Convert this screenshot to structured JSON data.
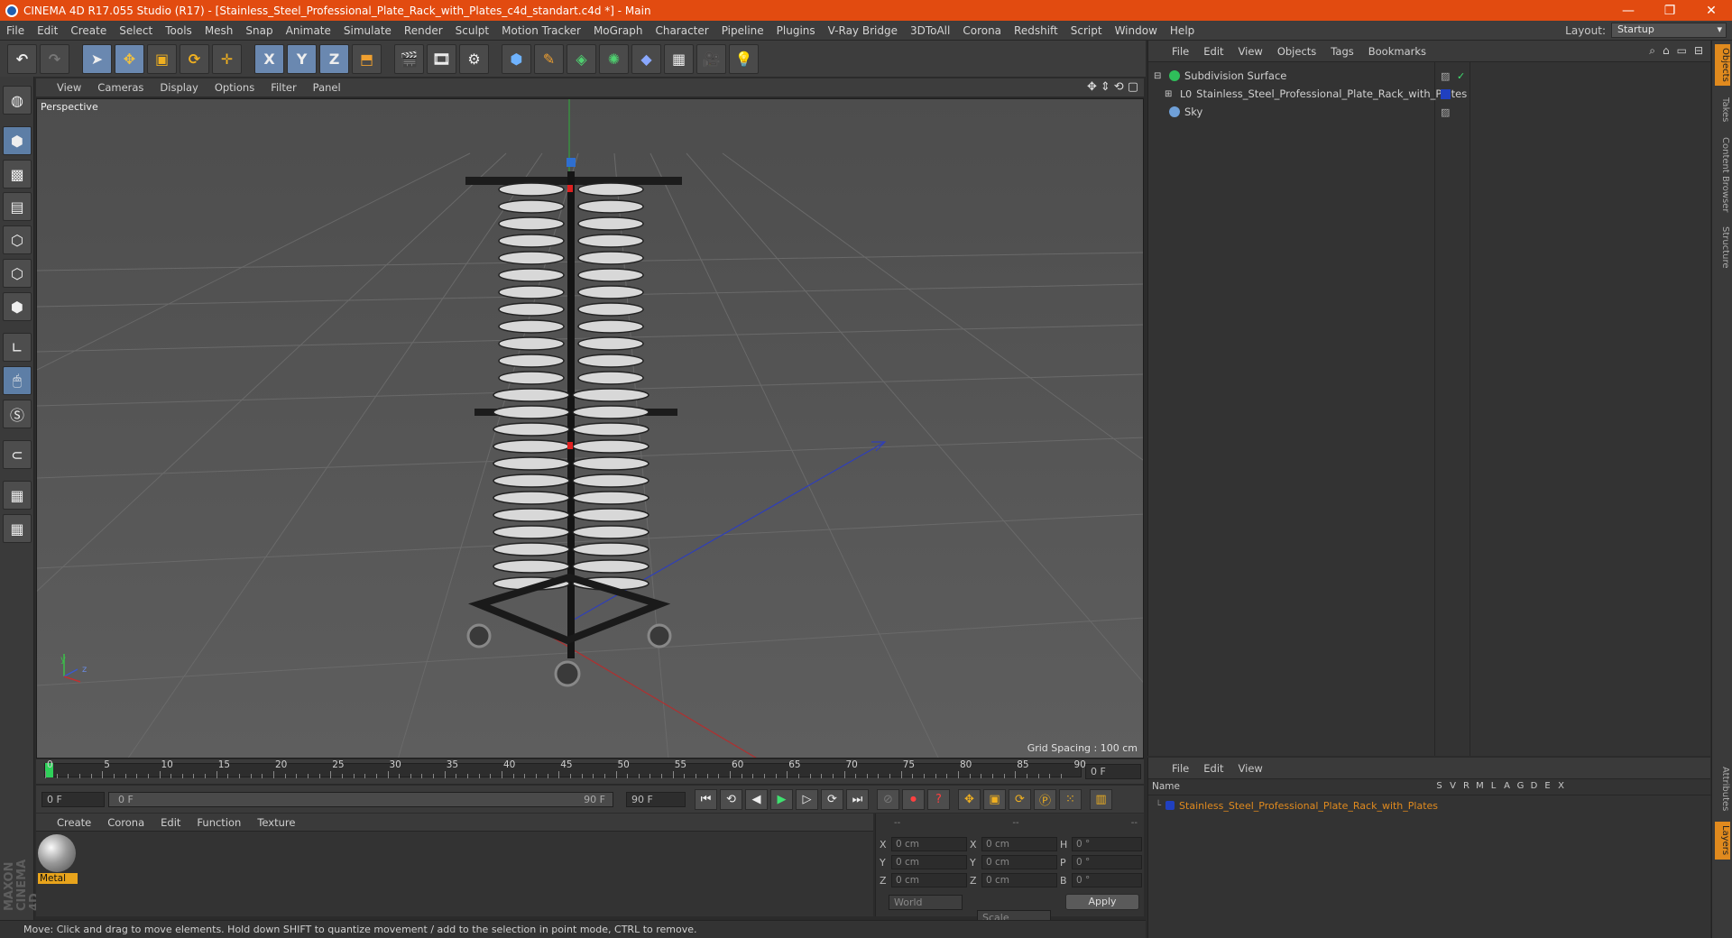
{
  "window": {
    "title": "CINEMA 4D R17.055 Studio (R17) - [Stainless_Steel_Professional_Plate_Rack_with_Plates_c4d_standart.c4d *] - Main",
    "minimize": "—",
    "maximize": "❐",
    "close": "✕"
  },
  "menubar": {
    "items": [
      "File",
      "Edit",
      "Create",
      "Select",
      "Tools",
      "Mesh",
      "Snap",
      "Animate",
      "Simulate",
      "Render",
      "Sculpt",
      "Motion Tracker",
      "MoGraph",
      "Character",
      "Pipeline",
      "Plugins",
      "V-Ray Bridge",
      "3DToAll",
      "Corona",
      "Redshift",
      "Script",
      "Window",
      "Help"
    ],
    "layout_label": "Layout:",
    "layout_value": "Startup"
  },
  "toolbar": {
    "x_label": "X",
    "y_label": "Y",
    "z_label": "Z"
  },
  "viewport": {
    "menu": [
      "View",
      "Cameras",
      "Display",
      "Options",
      "Filter",
      "Panel"
    ],
    "name": "Perspective",
    "grid_spacing": "Grid Spacing : 100 cm",
    "axis_y": "y",
    "axis_z": "z"
  },
  "timeline": {
    "ticks": [
      "0",
      "5",
      "10",
      "15",
      "20",
      "25",
      "30",
      "35",
      "40",
      "45",
      "50",
      "55",
      "60",
      "65",
      "70",
      "75",
      "80",
      "85",
      "90"
    ],
    "current_frame": "0 F",
    "start_frame": "0 F",
    "range_start": "0 F",
    "range_end": "90 F",
    "end_frame": "90 F"
  },
  "materials": {
    "menu": [
      "Create",
      "Corona",
      "Edit",
      "Function",
      "Texture"
    ],
    "items": [
      {
        "name": "Metal"
      }
    ]
  },
  "coordinates": {
    "headers": [
      "--",
      "--",
      "--"
    ],
    "rows": [
      {
        "l1": "X",
        "v1": "0 cm",
        "l2": "X",
        "v2": "0 cm",
        "l3": "H",
        "v3": "0 °"
      },
      {
        "l1": "Y",
        "v1": "0 cm",
        "l2": "Y",
        "v2": "0 cm",
        "l3": "P",
        "v3": "0 °"
      },
      {
        "l1": "Z",
        "v1": "0 cm",
        "l2": "Z",
        "v2": "0 cm",
        "l3": "B",
        "v3": "0 °"
      }
    ],
    "world": "World",
    "scale": "Scale",
    "apply": "Apply"
  },
  "status": "Move: Click and drag to move elements. Hold down SHIFT to quantize movement / add to the selection in point mode, CTRL to remove.",
  "objects": {
    "menu": [
      "File",
      "Edit",
      "View",
      "Objects",
      "Tags",
      "Bookmarks"
    ],
    "items": [
      {
        "name": "Subdivision Surface",
        "color": "#2fbf5a"
      },
      {
        "name": "Stainless_Steel_Professional_Plate_Rack_with_Plates",
        "color": "#cfcfcf"
      },
      {
        "name": "Sky",
        "color": "#6fa0d8"
      }
    ]
  },
  "layers": {
    "menu": [
      "File",
      "Edit",
      "View"
    ],
    "col_name": "Name",
    "cols": [
      "S",
      "V",
      "R",
      "M",
      "L",
      "A",
      "G",
      "D",
      "E",
      "X"
    ],
    "row": "Stainless_Steel_Professional_Plate_Rack_with_Plates",
    "row_color": "#e08a1e"
  },
  "right_tabs": [
    "Objects",
    "Takes",
    "Content Browser",
    "Structure",
    "Attributes",
    "Layers"
  ],
  "brand": "MAXON CINEMA 4D"
}
